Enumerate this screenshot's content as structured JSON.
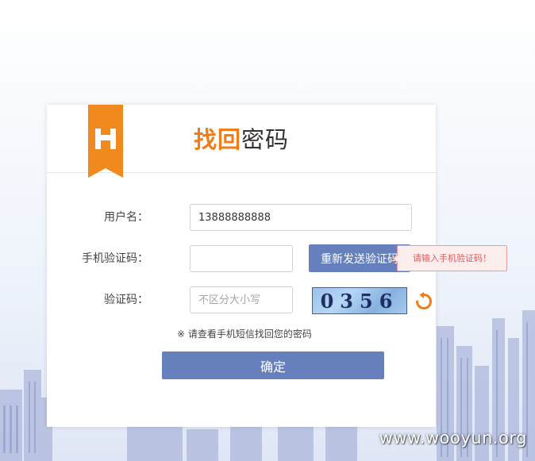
{
  "logo": {
    "letter": "H",
    "color": "#f18a1e"
  },
  "title": {
    "accent": "找回",
    "rest": "密码"
  },
  "form": {
    "username": {
      "label": "用户名：",
      "value": "13888888888"
    },
    "sms_code": {
      "label": "手机验证码：",
      "value": "",
      "resend_label": "重新发送验证码"
    },
    "captcha": {
      "label": "验证码：",
      "placeholder": "不区分大小写",
      "image_text": "0356",
      "refresh_icon": "refresh-icon"
    }
  },
  "tooltip": {
    "text": "请输入手机验证码！"
  },
  "notice": "※ 请查看手机短信找回您的密码",
  "confirm_label": "确定",
  "watermark": "www.wooyun.org",
  "colors": {
    "accent": "#ef7d1a",
    "button": "#6580bd",
    "tooltip_border": "#ed9b9b",
    "tooltip_text": "#e45959"
  }
}
